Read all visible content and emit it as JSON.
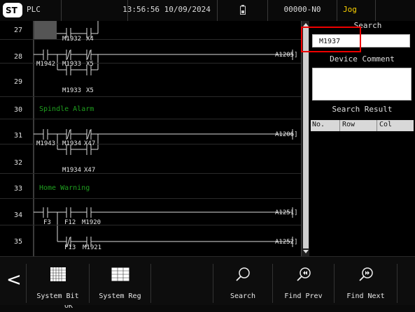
{
  "header": {
    "app_label": "PLC",
    "time": "13:56:56 10/09/2024",
    "program_id": "00000-N0",
    "mode": "Jog"
  },
  "ladder": {
    "rows": [
      {
        "num": "27",
        "contacts": [
          {
            "label": "M1932"
          },
          {
            "label": "X4"
          }
        ]
      },
      {
        "num": "28",
        "contacts": [
          {
            "label": "M1942"
          },
          {
            "label": "M1933"
          },
          {
            "label": "X5"
          }
        ],
        "coil": "A1205]"
      },
      {
        "num": "29",
        "contacts": [
          {
            "label": "M1933"
          },
          {
            "label": "X5"
          }
        ]
      },
      {
        "num": "30",
        "comment": "Spindle Alarm"
      },
      {
        "num": "31",
        "contacts": [
          {
            "label": "M1943"
          },
          {
            "label": "M1934"
          },
          {
            "label": "X47"
          }
        ],
        "coil": "A1206]"
      },
      {
        "num": "32",
        "contacts": [
          {
            "label": "M1934"
          },
          {
            "label": "X47"
          }
        ]
      },
      {
        "num": "33",
        "comment": "Home Warning"
      },
      {
        "num": "34",
        "contacts": [
          {
            "label": "F3"
          },
          {
            "label": "F12"
          },
          {
            "label": "M1920"
          }
        ],
        "coil": "A1251]"
      },
      {
        "num": "35",
        "contacts": [
          {
            "label": "F13"
          },
          {
            "label": "M1921"
          }
        ],
        "coil": "A1252]"
      }
    ]
  },
  "side_panel": {
    "search_title": "Search",
    "search_value": "M1937",
    "device_comment_title": "Device Comment",
    "search_result_title": "Search Result",
    "result_columns": [
      "No.",
      "Row",
      "Col"
    ]
  },
  "toolbar": {
    "back_label": "<",
    "buttons": [
      {
        "label": "System Bit",
        "icon": "grid-icon"
      },
      {
        "label": "System Reg",
        "icon": "table-icon"
      },
      {
        "label": "",
        "icon": ""
      },
      {
        "label": "Search",
        "icon": "magnifier-icon"
      },
      {
        "label": "Find Prev",
        "icon": "magnifier-prev-icon"
      },
      {
        "label": "Find Next",
        "icon": "magnifier-next-icon"
      }
    ]
  },
  "status": {
    "text": "OK"
  },
  "colors": {
    "accent": "#ffd400",
    "highlight": "#e00000",
    "ladder_label": "#1fbf1f"
  }
}
